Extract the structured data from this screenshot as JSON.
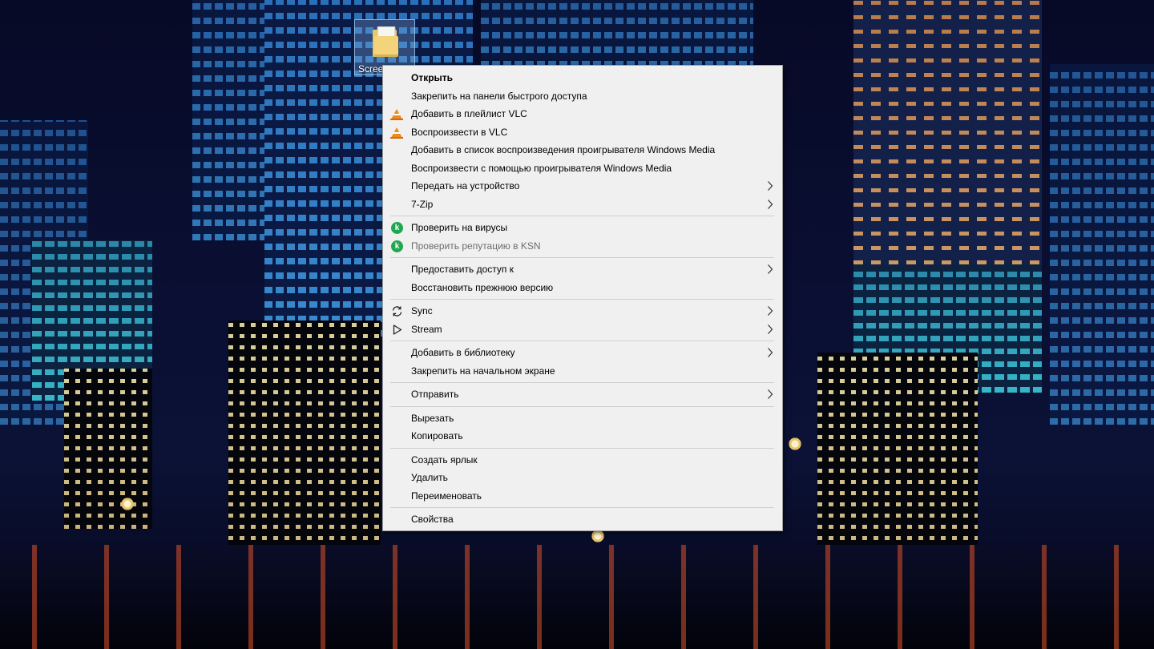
{
  "desktop": {
    "icon_label": "Scree"
  },
  "context_menu": {
    "groups": [
      [
        {
          "label": "Открыть",
          "bold": true
        },
        {
          "label": "Закрепить на панели быстрого доступа"
        },
        {
          "label": "Добавить в плейлист VLC",
          "icon": "vlc-icon"
        },
        {
          "label": "Воспроизвести в VLC",
          "icon": "vlc-icon"
        },
        {
          "label": "Добавить в список воспроизведения проигрывателя Windows Media"
        },
        {
          "label": "Воспроизвести с помощью проигрывателя Windows Media"
        },
        {
          "label": "Передать на устройство",
          "submenu": true
        },
        {
          "label": "7-Zip",
          "submenu": true
        }
      ],
      [
        {
          "label": "Проверить на вирусы",
          "icon": "kaspersky-icon"
        },
        {
          "label": "Проверить репутацию в KSN",
          "icon": "kaspersky-icon",
          "disabled": true
        }
      ],
      [
        {
          "label": "Предоставить доступ к",
          "submenu": true
        },
        {
          "label": "Восстановить прежнюю версию"
        }
      ],
      [
        {
          "label": "Sync",
          "icon": "sync-icon",
          "submenu": true
        },
        {
          "label": "Stream",
          "icon": "play-icon",
          "submenu": true
        }
      ],
      [
        {
          "label": "Добавить в библиотеку",
          "submenu": true
        },
        {
          "label": "Закрепить на начальном экране"
        }
      ],
      [
        {
          "label": "Отправить",
          "submenu": true
        }
      ],
      [
        {
          "label": "Вырезать"
        },
        {
          "label": "Копировать"
        }
      ],
      [
        {
          "label": "Создать ярлык"
        },
        {
          "label": "Удалить"
        },
        {
          "label": "Переименовать"
        }
      ],
      [
        {
          "label": "Свойства"
        }
      ]
    ]
  },
  "colors": {
    "menu_bg": "#f0f0f0",
    "separator": "#cfcfcf",
    "disabled_text": "#6d6d6d",
    "vlc_orange": "#f08a1a",
    "kaspersky_green": "#1fa84f"
  }
}
